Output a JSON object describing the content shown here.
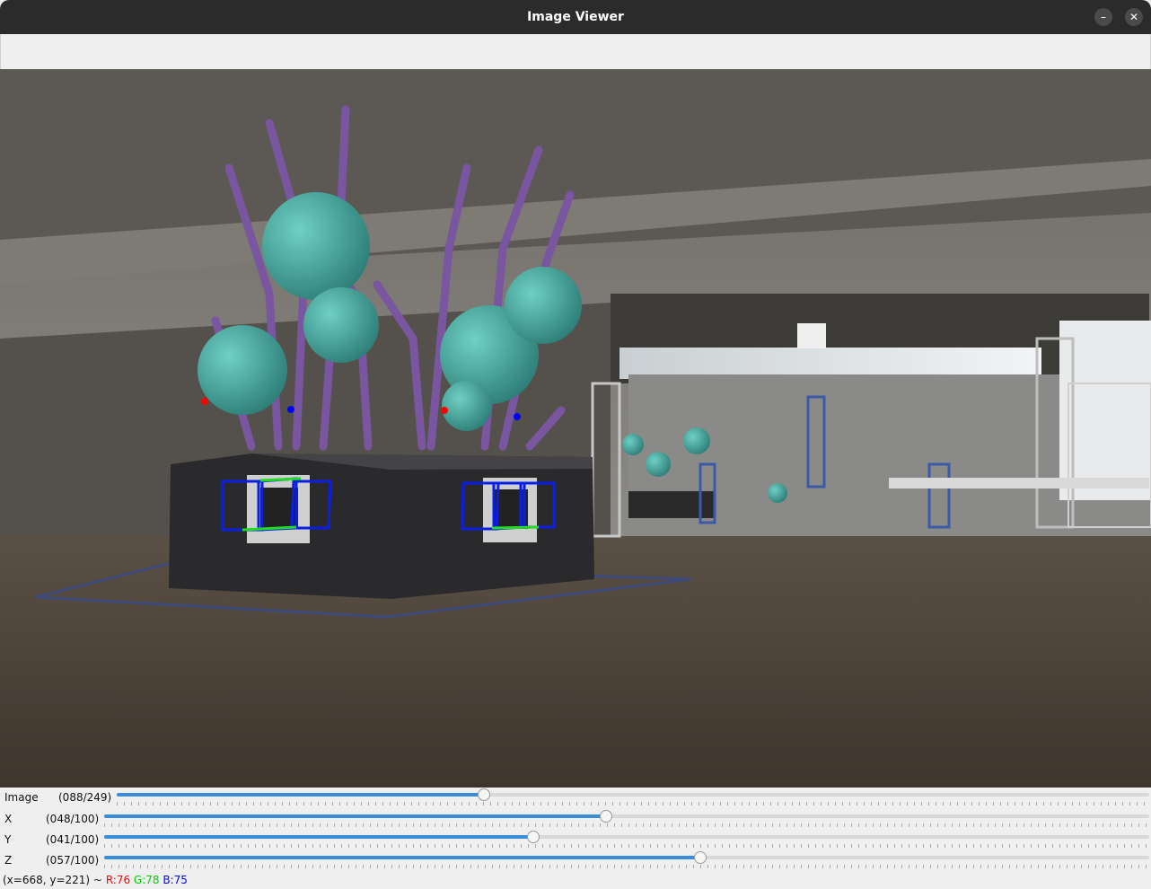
{
  "window": {
    "title": "Image Viewer",
    "minimize_icon": "minimize-icon",
    "close_icon": "close-icon"
  },
  "sliders": [
    {
      "label": "Image",
      "counter": "(088/249)",
      "value": 88,
      "max": 249
    },
    {
      "label": "X",
      "counter": "(048/100)",
      "value": 48,
      "max": 100
    },
    {
      "label": "Y",
      "counter": "(041/100)",
      "value": 41,
      "max": 100
    },
    {
      "label": "Z",
      "counter": "(057/100)",
      "value": 57,
      "max": 100
    }
  ],
  "status": {
    "coords": "(x=668, y=221) ~",
    "r": "R:76",
    "g": "G:78",
    "b": "B:75"
  },
  "colors": {
    "r": "#ff0000",
    "g": "#00cc00",
    "b": "#0000ff",
    "slider_fill": "#3a8ed8",
    "box_blue": "#0a1ee6",
    "box_green": "#22dd22"
  }
}
